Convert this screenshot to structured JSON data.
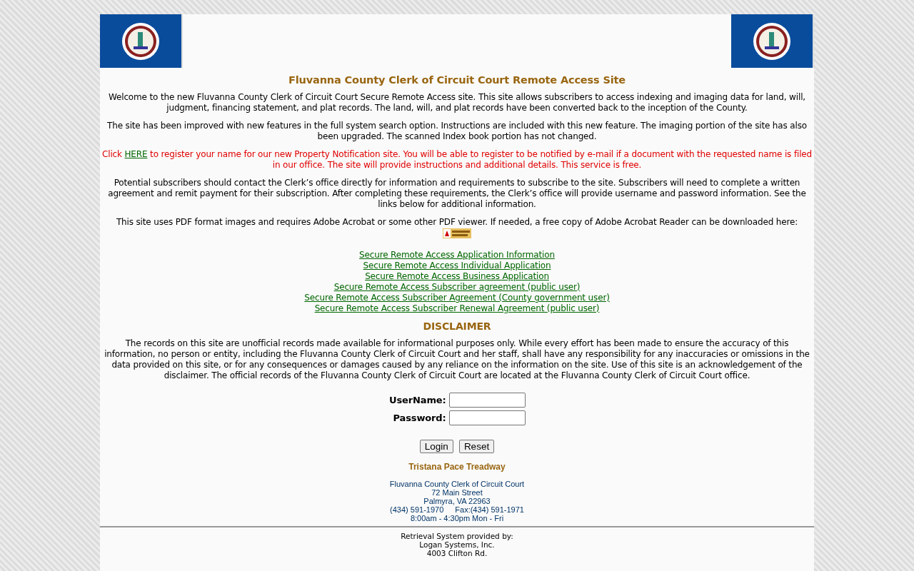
{
  "title": "Fluvanna County Clerk of Circuit Court Remote Access Site",
  "paragraphs": [
    {
      "kind": "plain",
      "text": "Welcome to the new Fluvanna County Clerk of Circuit Court Secure Remote Access site. This site allows subscribers to access indexing and imaging data for land, will, judgment, financing statement, and plat records. The land, will, and plat records have been converted back to the inception of the County."
    },
    {
      "kind": "plain",
      "text": "The site has been improved with new features in the full system search option. Instructions are included with this new feature. The imaging portion of the site has also been upgraded. The scanned Index book portion has not changed."
    },
    {
      "kind": "notice",
      "before": "Click ",
      "link": "HERE",
      "after": " to register your name for our new Property Notification site. You will be able to register to be notified by e-mail if a document with the requested name is filed in our office. The site will provide instructions and additional details. This service is free."
    },
    {
      "kind": "plain",
      "text": "Potential subscribers should contact the Clerk’s office directly for information and requirements to subscribe to the site. Subscribers will need to complete a written agreement and remit payment for their subscription. After completing these requirements, the Clerk’s office will provide username and password information. See the links below for additional information."
    },
    {
      "kind": "acrobat",
      "text": "This site uses PDF format images and requires Adobe Acrobat or some other PDF viewer.   If needed, a free copy of Adobe Acrobat Reader can be downloaded here:"
    }
  ],
  "links": [
    "Secure Remote Access Application Information",
    "Secure Remote Access Individual Application",
    "Secure Remote Access Business Application",
    "Secure Remote Access Subscriber agreement (public user)",
    "Secure Remote Access Subscriber Agreement (County government user)",
    "Secure Remote Access Subscriber Renewal Agreement (public user)"
  ],
  "disclaimer": {
    "heading": "DISCLAIMER",
    "text": "The records on this site are unofficial records made available for informational purposes only. While every effort has been made to ensure the accuracy of this information, no person or entity, including the Fluvanna County Clerk of Circuit Court and her staff, shall have any responsibility for any inaccuracies or omissions in the data provided on this site, or for any consequences or damages caused by any reliance on the information on the site. Use of this site is an acknowledgement of the disclaimer. The official records of the Fluvanna County Clerk of Circuit Court are located at the Fluvanna County Clerk of Circuit Court office."
  },
  "login": {
    "fields": [
      {
        "label": "UserName:"
      },
      {
        "label": "Password:"
      }
    ],
    "buttons": [
      "Login",
      "Reset"
    ]
  },
  "clerk": "Tristana Pace Treadway",
  "address": [
    "Fluvanna County Clerk of Circuit Court",
    "72 Main Street",
    "Palmyra, VA 22963"
  ],
  "phone": "(434) 591-1970",
  "fax": "Fax:(434) 591-1971",
  "hours": "8:00am - 4:30pm Mon - Fri",
  "provider": [
    "Retrieval System provided by:",
    "Logan Systems, Inc.",
    "4003 Clifton Rd."
  ]
}
